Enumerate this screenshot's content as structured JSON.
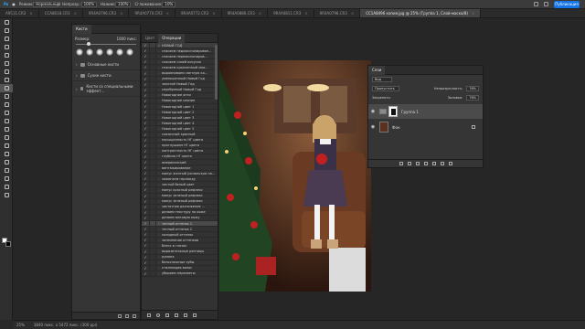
{
  "options_bar": {
    "mode_label": "Режим:",
    "mode_value": "Нормальный",
    "opacity_label": "Непрозр.:",
    "opacity_value": "100%",
    "flow_label": "Нажим:",
    "flow_value": "100%",
    "smoothing_label": "Сглаживание:",
    "smoothing_value": "10%",
    "share_label": "Публикация"
  },
  "tabs": [
    {
      "label": "A9511.CR3"
    },
    {
      "label": "CCA8618.CR3"
    },
    {
      "label": "9R4A0796.CR3"
    },
    {
      "label": "9R4A0770.CR3"
    },
    {
      "label": "9R4A0772.CR3"
    },
    {
      "label": "9R4A0886.CR3"
    },
    {
      "label": "9R4A0811.CR3"
    },
    {
      "label": "9R4A0798.CR3"
    },
    {
      "label": "CC1A8496 копия.jpg @ 25% (Группа 1, Слой-маска/8)"
    }
  ],
  "brushes_panel": {
    "tab_brushes": "Кисти",
    "size_label": "Размер:",
    "size_value": "1000 пикс.",
    "folders": [
      {
        "label": "Основные кисти"
      },
      {
        "label": "Сухие кисти"
      },
      {
        "label": "Кисти со специальными эффект..."
      }
    ]
  },
  "actions_panel": {
    "tab_color": "Цвет",
    "tab_actions": "Операции",
    "set_name": "НОВЫЙ ГОД",
    "items": [
      {
        "label": "спасаем недоэкспонирован..."
      },
      {
        "label": "спасаем переэкспониров..."
      },
      {
        "label": "спасаем слоей искусин"
      },
      {
        "label": "спасаем кропленный мно..."
      },
      {
        "label": "выравниваем светлую ко..."
      },
      {
        "label": "уменьшенный Новый Год"
      },
      {
        "label": "золотой Новый Год"
      },
      {
        "label": "серебряный Новый Год"
      },
      {
        "label": "Новогодние огни"
      },
      {
        "label": "Новогодние сияние"
      },
      {
        "label": "Новогодний цвет 1"
      },
      {
        "label": "Новогодний цвет 2"
      },
      {
        "label": "Новогодний цвет 3"
      },
      {
        "label": "Новогодний цвет 4"
      },
      {
        "label": "Новогодний цвет 5"
      },
      {
        "label": "сказочный красный"
      },
      {
        "label": "насыщенность НГ цвета"
      },
      {
        "label": "приглушаем НГ цвета"
      },
      {
        "label": "контрастность НГ цвета"
      },
      {
        "label": "глубина НГ цвета"
      },
      {
        "label": "американский"
      },
      {
        "label": "винтажирование"
      },
      {
        "label": "минус желтый (использую на..."
      },
      {
        "label": "зажигаем гирлянду"
      },
      {
        "label": "чистый белый цвет"
      },
      {
        "label": "минус красный рефлекс"
      },
      {
        "label": "минус зеленый рефлекс"
      },
      {
        "label": "минус зеленый рефлекс"
      },
      {
        "label": "частотное разложение ..."
      },
      {
        "label": "делаем текстуру на коже"
      },
      {
        "label": "делаем матовую кожу"
      },
      {
        "label": "теплый оттенок 1"
      },
      {
        "label": "теплый оттенок 2"
      },
      {
        "label": "холодный оттенок"
      },
      {
        "label": "затемнение оттенков"
      },
      {
        "label": "блеск в глазах"
      },
      {
        "label": "выразительные ресницы"
      },
      {
        "label": "румяна"
      },
      {
        "label": "белоснежные зубы"
      },
      {
        "label": "стилизация волос"
      },
      {
        "label": "убираем пересветы"
      }
    ]
  },
  "layers_panel": {
    "title": "Слои",
    "filter_value": "Вид",
    "blend_mode": "Пропустить",
    "opacity_label": "Непрозрачность:",
    "opacity_value": "76%",
    "lock_label": "Закрепить:",
    "fill_label": "Заливка:",
    "fill_value": "76%",
    "layers": [
      {
        "name": "Группа 1"
      },
      {
        "name": "Фон"
      }
    ]
  },
  "status": {
    "zoom": "25%",
    "doc_info": "3840 пикс. x 5472 пикс. (300 ppi)"
  }
}
